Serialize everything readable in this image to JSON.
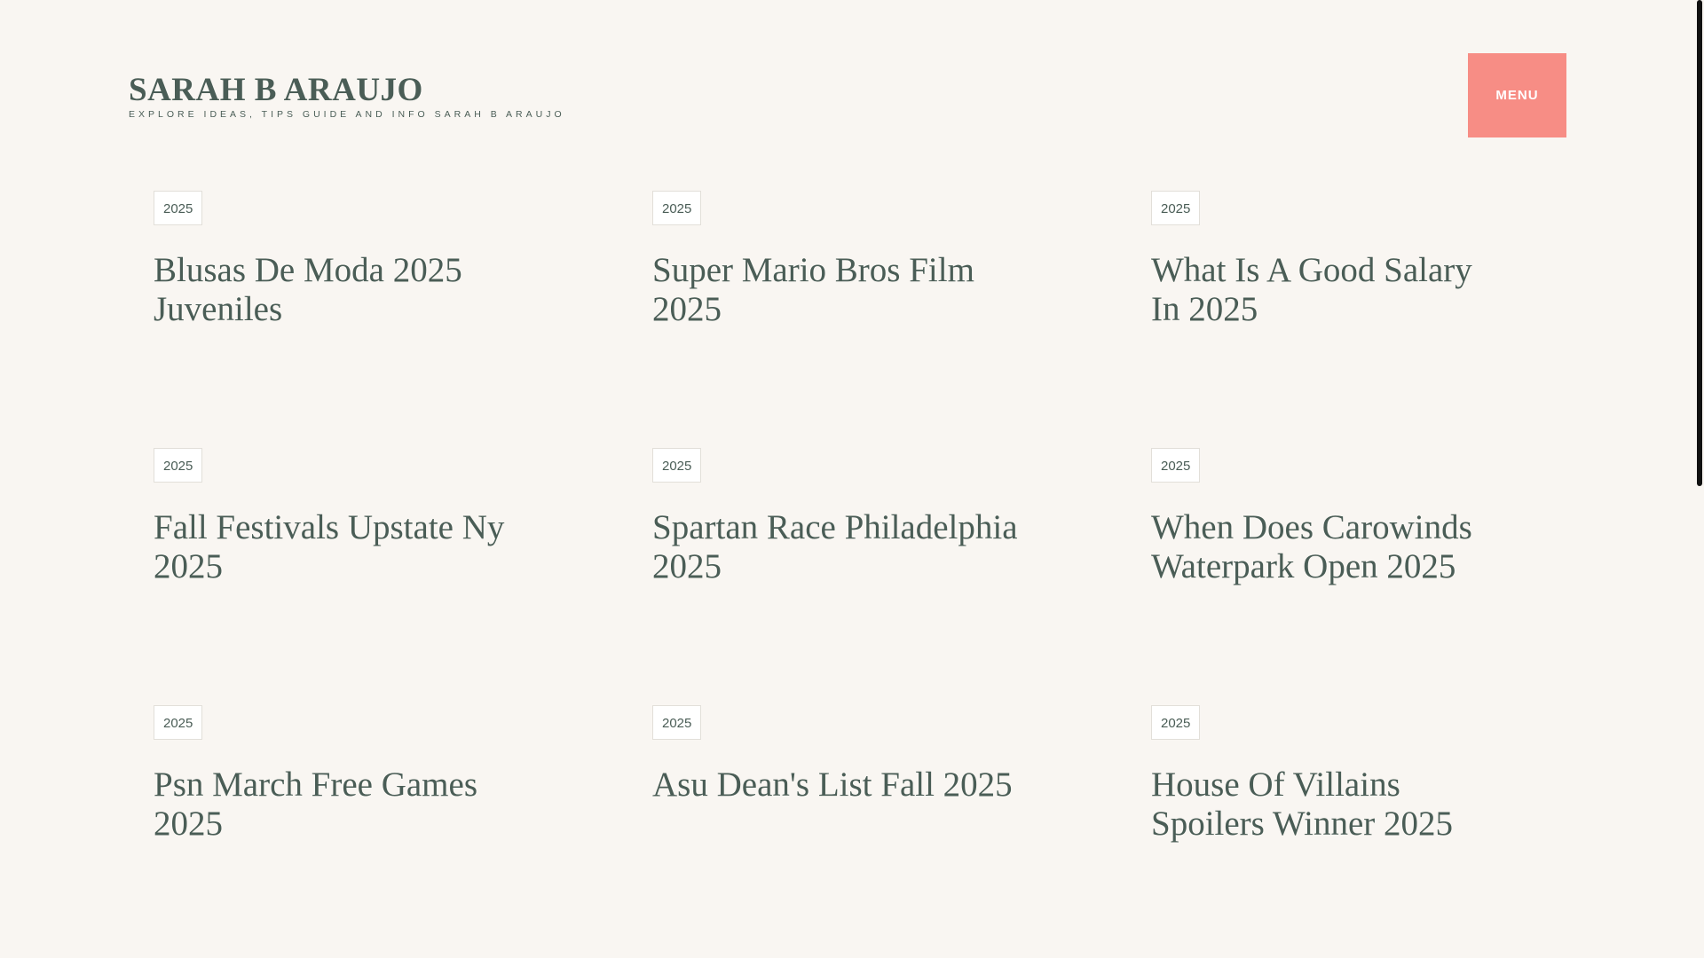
{
  "site": {
    "title": "SARAH B ARAUJO",
    "tagline": "EXPLORE IDEAS, TIPS GUIDE AND INFO SARAH B ARAUJO"
  },
  "header": {
    "menu_label": "MENU"
  },
  "colors": {
    "background": "#f9f6f2",
    "text": "#4a5d56",
    "menu_accent": "#f78d85"
  },
  "posts": [
    {
      "year": "2025",
      "title": "Blusas De Moda 2025 Juveniles"
    },
    {
      "year": "2025",
      "title": "Super Mario Bros Film 2025"
    },
    {
      "year": "2025",
      "title": "What Is A Good Salary In 2025"
    },
    {
      "year": "2025",
      "title": "Fall Festivals Upstate Ny 2025"
    },
    {
      "year": "2025",
      "title": "Spartan Race Philadelphia 2025"
    },
    {
      "year": "2025",
      "title": "When Does Carowinds Waterpark Open 2025"
    },
    {
      "year": "2025",
      "title": "Psn March Free Games 2025"
    },
    {
      "year": "2025",
      "title": "Asu Dean's List Fall 2025"
    },
    {
      "year": "2025",
      "title": "House Of Villains Spoilers Winner 2025"
    }
  ]
}
